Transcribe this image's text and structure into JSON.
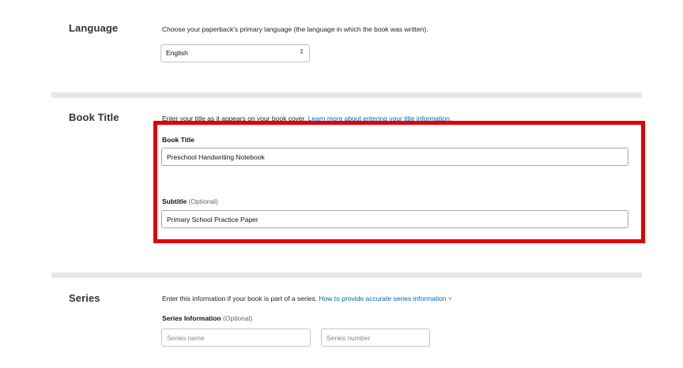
{
  "language": {
    "label": "Language",
    "description": "Choose your paperback's primary language (the language in which the book was written).",
    "selected": "English",
    "arrow": "⇕"
  },
  "book_title": {
    "label": "Book Title",
    "description": "Enter your title as it appears on your book cover.",
    "learn_more_link": "Learn more about entering your title information.",
    "title_field_label": "Book Title",
    "title_value": "Preschool Handwriting Notebook",
    "subtitle_field_label": "Subtitle",
    "subtitle_optional": "(Optional)",
    "subtitle_value": "Primary School Practice Paper"
  },
  "series": {
    "label": "Series",
    "description": "Enter this information if your book is part of a series.",
    "help_link": "How to provide accurate series information",
    "help_caret": "˅",
    "info_label": "Series Information",
    "info_optional": "(Optional)",
    "name_placeholder": "Series name",
    "number_placeholder": "Series number"
  },
  "colors": {
    "highlight": "#e00000",
    "link": "#0066c0",
    "divider": "#e7e7e7"
  }
}
